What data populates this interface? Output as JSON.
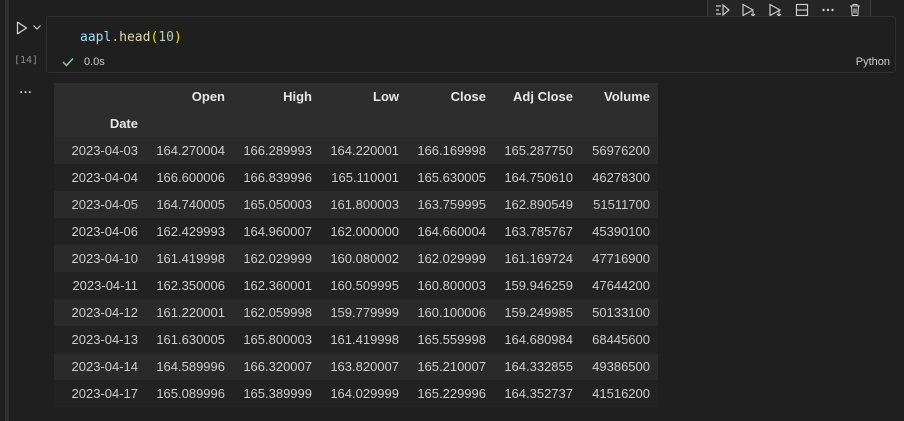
{
  "cell": {
    "execution_count": "[14]",
    "code": {
      "var": "aapl",
      "dot": ".",
      "fn": "head",
      "open_paren": "(",
      "arg": "10",
      "close_paren": ")"
    },
    "exec_time": "0.0s",
    "language": "Python"
  },
  "toolbar": {
    "icons": [
      "execute-above-icon",
      "execute-below-icon",
      "run-to-cursor-icon",
      "split-cell-icon",
      "more-actions-icon",
      "delete-cell-icon"
    ]
  },
  "output": {
    "more_label": "...",
    "dataframe": {
      "index_name": "Date",
      "columns": [
        "Open",
        "High",
        "Low",
        "Close",
        "Adj Close",
        "Volume"
      ],
      "rows": [
        {
          "date": "2023-04-03",
          "values": [
            "164.270004",
            "166.289993",
            "164.220001",
            "166.169998",
            "165.287750",
            "56976200"
          ]
        },
        {
          "date": "2023-04-04",
          "values": [
            "166.600006",
            "166.839996",
            "165.110001",
            "165.630005",
            "164.750610",
            "46278300"
          ]
        },
        {
          "date": "2023-04-05",
          "values": [
            "164.740005",
            "165.050003",
            "161.800003",
            "163.759995",
            "162.890549",
            "51511700"
          ]
        },
        {
          "date": "2023-04-06",
          "values": [
            "162.429993",
            "164.960007",
            "162.000000",
            "164.660004",
            "163.785767",
            "45390100"
          ]
        },
        {
          "date": "2023-04-10",
          "values": [
            "161.419998",
            "162.029999",
            "160.080002",
            "162.029999",
            "161.169724",
            "47716900"
          ]
        },
        {
          "date": "2023-04-11",
          "values": [
            "162.350006",
            "162.360001",
            "160.509995",
            "160.800003",
            "159.946259",
            "47644200"
          ]
        },
        {
          "date": "2023-04-12",
          "values": [
            "161.220001",
            "162.059998",
            "159.779999",
            "160.100006",
            "159.249985",
            "50133100"
          ]
        },
        {
          "date": "2023-04-13",
          "values": [
            "161.630005",
            "165.800003",
            "161.419998",
            "165.559998",
            "164.680984",
            "68445600"
          ]
        },
        {
          "date": "2023-04-14",
          "values": [
            "164.589996",
            "166.320007",
            "163.820007",
            "165.210007",
            "164.332855",
            "49386500"
          ]
        },
        {
          "date": "2023-04-17",
          "values": [
            "165.089996",
            "165.389999",
            "164.029999",
            "165.229996",
            "164.352737",
            "41516200"
          ]
        }
      ]
    }
  },
  "colors": {
    "success": "#89d185",
    "background": "#1f1f1f"
  }
}
